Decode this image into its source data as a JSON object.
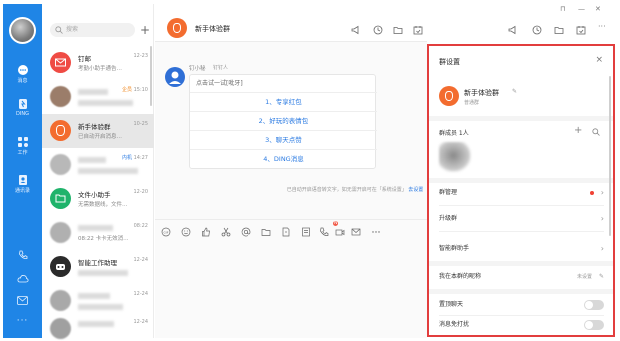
{
  "rail": {
    "items": [
      {
        "label": "消息",
        "icon": "message-icon"
      },
      {
        "label": "DING",
        "icon": "ding-icon"
      },
      {
        "label": "工作",
        "icon": "work-icon"
      },
      {
        "label": "通讯录",
        "icon": "contacts-icon"
      }
    ],
    "more": "···"
  },
  "list": {
    "search_placeholder": "搜索",
    "conversations": [
      {
        "name": "钉邮",
        "preview": "考勤小助手通告…",
        "time": "12-23"
      },
      {
        "name": "",
        "preview": "",
        "time": "15:10",
        "tag": "企员"
      },
      {
        "name": "新手体验群",
        "preview": "已自动开启消息…",
        "time": "10-25"
      },
      {
        "name": "",
        "preview": "",
        "time": "14:27",
        "tag": "内机"
      },
      {
        "name": "文件小助手",
        "preview": "无需数据线，文件…",
        "time": "12-20"
      },
      {
        "name": "",
        "preview": "08:22 卡卡无效消…",
        "time": "08:22"
      },
      {
        "name": "智能工作助理",
        "preview": "",
        "time": "12-24"
      },
      {
        "name": "",
        "preview": "",
        "time": "12-24"
      },
      {
        "name": "",
        "preview": "",
        "time": "12-24"
      }
    ]
  },
  "chat": {
    "title": "新手体验群",
    "sender": "钉小秘",
    "sender_tag": "钉钉人",
    "card_header": "点击试一试[吡牙]",
    "options": [
      "1、专享红包",
      "2、好玩的表情包",
      "3、聊天点赞",
      "4、DING消息"
    ],
    "system_note": "已自动开启语音转文字，如无需开启可在「系统设置」",
    "system_link": "去设置"
  },
  "panel": {
    "title": "群设置",
    "group_name": "新手体验群",
    "group_sub": "普通群",
    "members_label": "群成员 1人",
    "rows": {
      "manage": "群管理",
      "upgrade": "升级群",
      "assistant": "智能群助手",
      "nickname": "我在本群的昵称",
      "nickname_value": "未设置",
      "pin": "置顶聊天",
      "mute": "消息免打扰"
    }
  },
  "colors": {
    "accent": "#1f85e6",
    "group_orange": "#f36c2f",
    "highlight_border": "#e23d3d"
  }
}
